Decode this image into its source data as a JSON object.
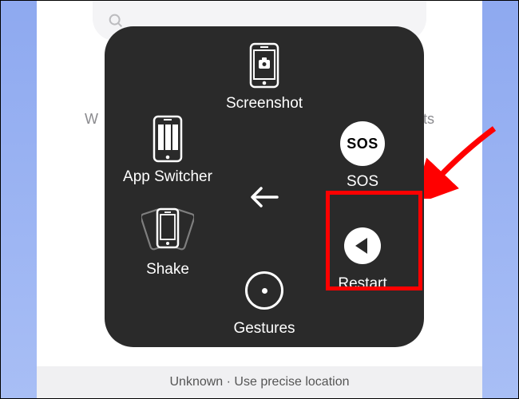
{
  "menu": {
    "screenshot": "Screenshot",
    "appSwitcher": "App Switcher",
    "sos": "SOS",
    "shake": "Shake",
    "restart": "Restart",
    "gestures": "Gestures"
  },
  "background": {
    "leftFragment": "W",
    "rightFragment": "ants",
    "bottomFragment": "Unknown · Use precise location"
  },
  "annotation": {
    "highlighted": "restart"
  },
  "colors": {
    "panel": "#2a2a2a",
    "highlight": "#ff0000"
  }
}
